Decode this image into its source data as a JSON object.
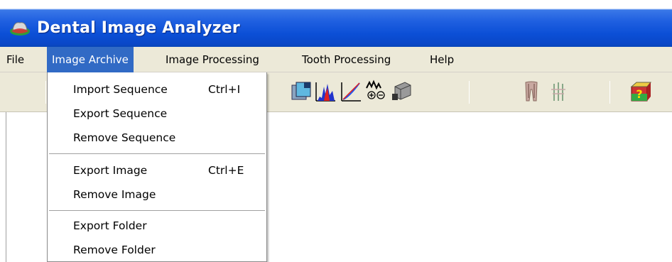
{
  "window": {
    "title": "Dental Image Analyzer",
    "icon": "tooth-app-icon"
  },
  "menubar": {
    "items": [
      {
        "label": "File",
        "active": false
      },
      {
        "label": "Image Archive",
        "active": true
      },
      {
        "label": "Image Processing",
        "active": false
      },
      {
        "label": "Tooth Processing",
        "active": false
      },
      {
        "label": "Help",
        "active": false
      }
    ]
  },
  "dropdown": {
    "groups": [
      [
        {
          "label": "Import Sequence",
          "shortcut": "Ctrl+I"
        },
        {
          "label": "Export Sequence",
          "shortcut": ""
        },
        {
          "label": "Remove Sequence",
          "shortcut": ""
        }
      ],
      [
        {
          "label": "Export Image",
          "shortcut": "Ctrl+E"
        },
        {
          "label": "Remove Image",
          "shortcut": ""
        }
      ],
      [
        {
          "label": "Export Folder",
          "shortcut": ""
        },
        {
          "label": "Remove Folder",
          "shortcut": ""
        }
      ]
    ]
  },
  "toolbar": {
    "icons": [
      "image-enhance-icon",
      "histogram-icon",
      "curve-icon",
      "zoom-in-out-icon",
      "filter-icon",
      "tooth-icon",
      "tooth-roots-icon",
      "help-icon"
    ]
  },
  "colors": {
    "title_blue": "#0b4fd6",
    "menu_highlight": "#316ac5",
    "menu_bg": "#ece9d8"
  }
}
